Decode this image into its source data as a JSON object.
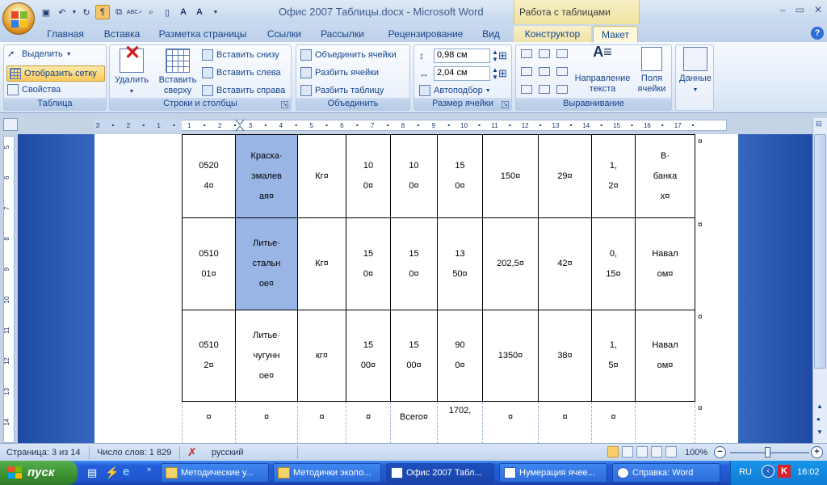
{
  "window": {
    "title": "Офис 2007 Таблицы.docx - Microsoft Word",
    "context_group": "Работа с таблицами",
    "controls": [
      "–",
      "▭",
      "✕"
    ]
  },
  "tabs": [
    "Главная",
    "Вставка",
    "Разметка страницы",
    "Ссылки",
    "Рассылки",
    "Рецензирование",
    "Вид",
    "Конструктор",
    "Макет"
  ],
  "selected_tab": "Макет",
  "ribbon": {
    "table": {
      "label": "Таблица",
      "select": "Выделить",
      "show_grid": "Отобразить сетку",
      "properties": "Свойства"
    },
    "rows_cols": {
      "label": "Строки и столбцы",
      "delete": "Удалить",
      "insert_above_1": "Вставить",
      "insert_above_2": "сверху",
      "insert_below": "Вставить снизу",
      "insert_left": "Вставить слева",
      "insert_right": "Вставить справа"
    },
    "merge": {
      "label": "Объединить",
      "merge_cells": "Объединить ячейки",
      "split_cells": "Разбить ячейки",
      "split_table": "Разбить таблицу"
    },
    "cell_size": {
      "label": "Размер ячейки",
      "height": "0,98 см",
      "width": "2,04 см",
      "autofit": "Автоподбор"
    },
    "alignment": {
      "label": "Выравнивание",
      "text_dir_1": "Направление",
      "text_dir_2": "текста",
      "margins_1": "Поля",
      "margins_2": "ячейки"
    },
    "data": {
      "label": "Данные"
    }
  },
  "ruler": {
    "ticks": [
      "3",
      "2",
      "1",
      "1",
      "2",
      "3",
      "4",
      "5",
      "6",
      "7",
      "8",
      "9",
      "10",
      "11",
      "12",
      "13",
      "14",
      "15",
      "16",
      "17"
    ],
    "vticks": [
      "5",
      "6",
      "7",
      "8",
      "9",
      "10",
      "11",
      "12",
      "13",
      "14"
    ]
  },
  "table": {
    "rows": [
      {
        "code": [
          "0520",
          "4¤"
        ],
        "name": [
          "Краска·",
          "эмалев",
          "ая¤"
        ],
        "unit": "Кг¤",
        "c1": [
          "10",
          "0¤"
        ],
        "c2": [
          "10",
          "0¤"
        ],
        "c3": [
          "15",
          "0¤"
        ],
        "sum": "150¤",
        "n": "29¤",
        "k": [
          "1,",
          "2¤"
        ],
        "pack": [
          "В·",
          "банка",
          "х¤"
        ]
      },
      {
        "code": [
          "0510",
          "01¤"
        ],
        "name": [
          "Литье·",
          "стальн",
          "ое¤"
        ],
        "unit": "Кг¤",
        "c1": [
          "15",
          "0¤"
        ],
        "c2": [
          "15",
          "0¤"
        ],
        "c3": [
          "13",
          "50¤"
        ],
        "sum": "202,5¤",
        "n": "42¤",
        "k": [
          "0,",
          "15¤"
        ],
        "pack": [
          "Навал",
          "ом¤"
        ]
      },
      {
        "code": [
          "0510",
          "2¤"
        ],
        "name": [
          "Литье·",
          "чугунн",
          "ое¤"
        ],
        "unit": "кг¤",
        "c1": [
          "15",
          "00¤"
        ],
        "c2": [
          "15",
          "00¤"
        ],
        "c3": [
          "90",
          "0¤"
        ],
        "sum": "1350¤",
        "n": "38¤",
        "k": [
          "1,",
          "5¤"
        ],
        "pack": [
          "Навал",
          "ом¤"
        ]
      }
    ],
    "last_row": {
      "marks": [
        "¤",
        "¤",
        "¤",
        "¤"
      ],
      "total": "Всего¤",
      "total_sum": "1702,",
      "marks_end": [
        "¤",
        "¤",
        "¤"
      ]
    },
    "end_of_row_mark": "¤"
  },
  "status": {
    "page": "Страница: 3 из 14",
    "words": "Число слов: 1 829",
    "lang": "русский",
    "zoom": "100%"
  },
  "taskbar": {
    "start": "пуск",
    "buttons": [
      "Методические у...",
      "Методички эколо...",
      "Офис 2007 Табл...",
      "Нумерация ячее...",
      "Справка: Word"
    ],
    "lang": "RU",
    "time": "16:02"
  }
}
